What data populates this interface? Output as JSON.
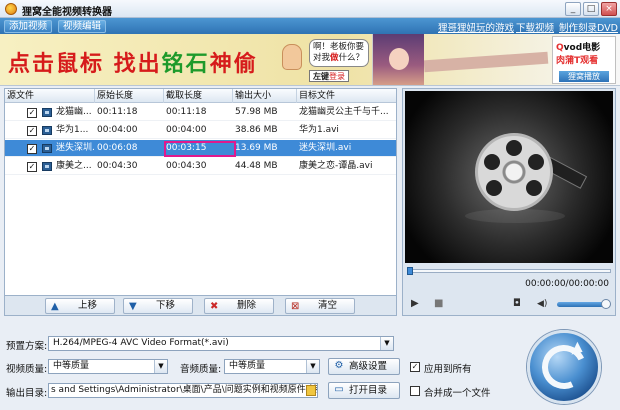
{
  "window": {
    "title": "狸窝全能视频转换器",
    "min_label": "_",
    "max_label": "□",
    "close_label": "×"
  },
  "menubar": {
    "add_video": "添加视频",
    "edit_video": "视频编辑",
    "games_link": "狸哥狸妞玩的游戏",
    "download_link": "下载视频",
    "burn_link": "制作刻录DVD"
  },
  "banner": {
    "slogan_red": "点击鼠标 找出",
    "slogan_green": "铭石",
    "slogan_red2": "神偷",
    "speech_l1": "啊！老板你要",
    "speech_l2a": "对我",
    "speech_l2b": "做",
    "speech_l2c": "什么？",
    "button_a": "左键",
    "button_b": "登录",
    "vod_title_a": "Q",
    "vod_title_b": "vod电影",
    "vod_sub": "肉蒲T观看",
    "vod_link": "狸窝播放"
  },
  "table": {
    "columns": [
      "源文件",
      "原始长度",
      "截取长度",
      "输出大小",
      "目标文件"
    ],
    "rows": [
      {
        "checked": true,
        "source": "龙猫幽...",
        "original": "00:11:18",
        "clip": "00:11:18",
        "size": "57.98 MB",
        "target": "龙猫幽灵公主千与千...",
        "selected": false
      },
      {
        "checked": true,
        "source": "华为1...",
        "original": "00:04:00",
        "clip": "00:04:00",
        "size": "38.86 MB",
        "target": "华为1.avi",
        "selected": false
      },
      {
        "checked": true,
        "source": "迷失深圳...",
        "original": "00:06:08",
        "clip": "00:03:15",
        "size": "13.69 MB",
        "target": "迷失深圳.avi",
        "selected": true
      },
      {
        "checked": true,
        "source": "康美之...",
        "original": "00:04:30",
        "clip": "00:04:30",
        "size": "44.48 MB",
        "target": "康美之恋-谭晶.avi",
        "selected": false
      }
    ],
    "check_glyph": "✓"
  },
  "list_actions": {
    "up": "上移",
    "down": "下移",
    "delete": "删除",
    "clear": "清空"
  },
  "preview": {
    "time": "00:00:00/00:00:00",
    "play_glyph": "▶",
    "stop_glyph": "■",
    "camera_glyph": "◘",
    "volume_glyph": "◀)"
  },
  "settings": {
    "preset_label": "预置方案:",
    "preset_value": "H.264/MPEG-4 AVC Video Format(*.avi)",
    "video_quality_label": "视频质量:",
    "video_quality_value": "中等质量",
    "audio_quality_label": "音频质量:",
    "audio_quality_value": "中等质量",
    "advanced_button": "高级设置",
    "apply_all": "应用到所有",
    "apply_all_checked": true,
    "output_label": "输出目录:",
    "output_path": "s and Settings\\Administrator\\桌面\\产品\\问题实例和视频原件\\转换",
    "open_dir_button": "打开目录",
    "merge_label": "合并成一个文件",
    "merge_checked": false
  }
}
